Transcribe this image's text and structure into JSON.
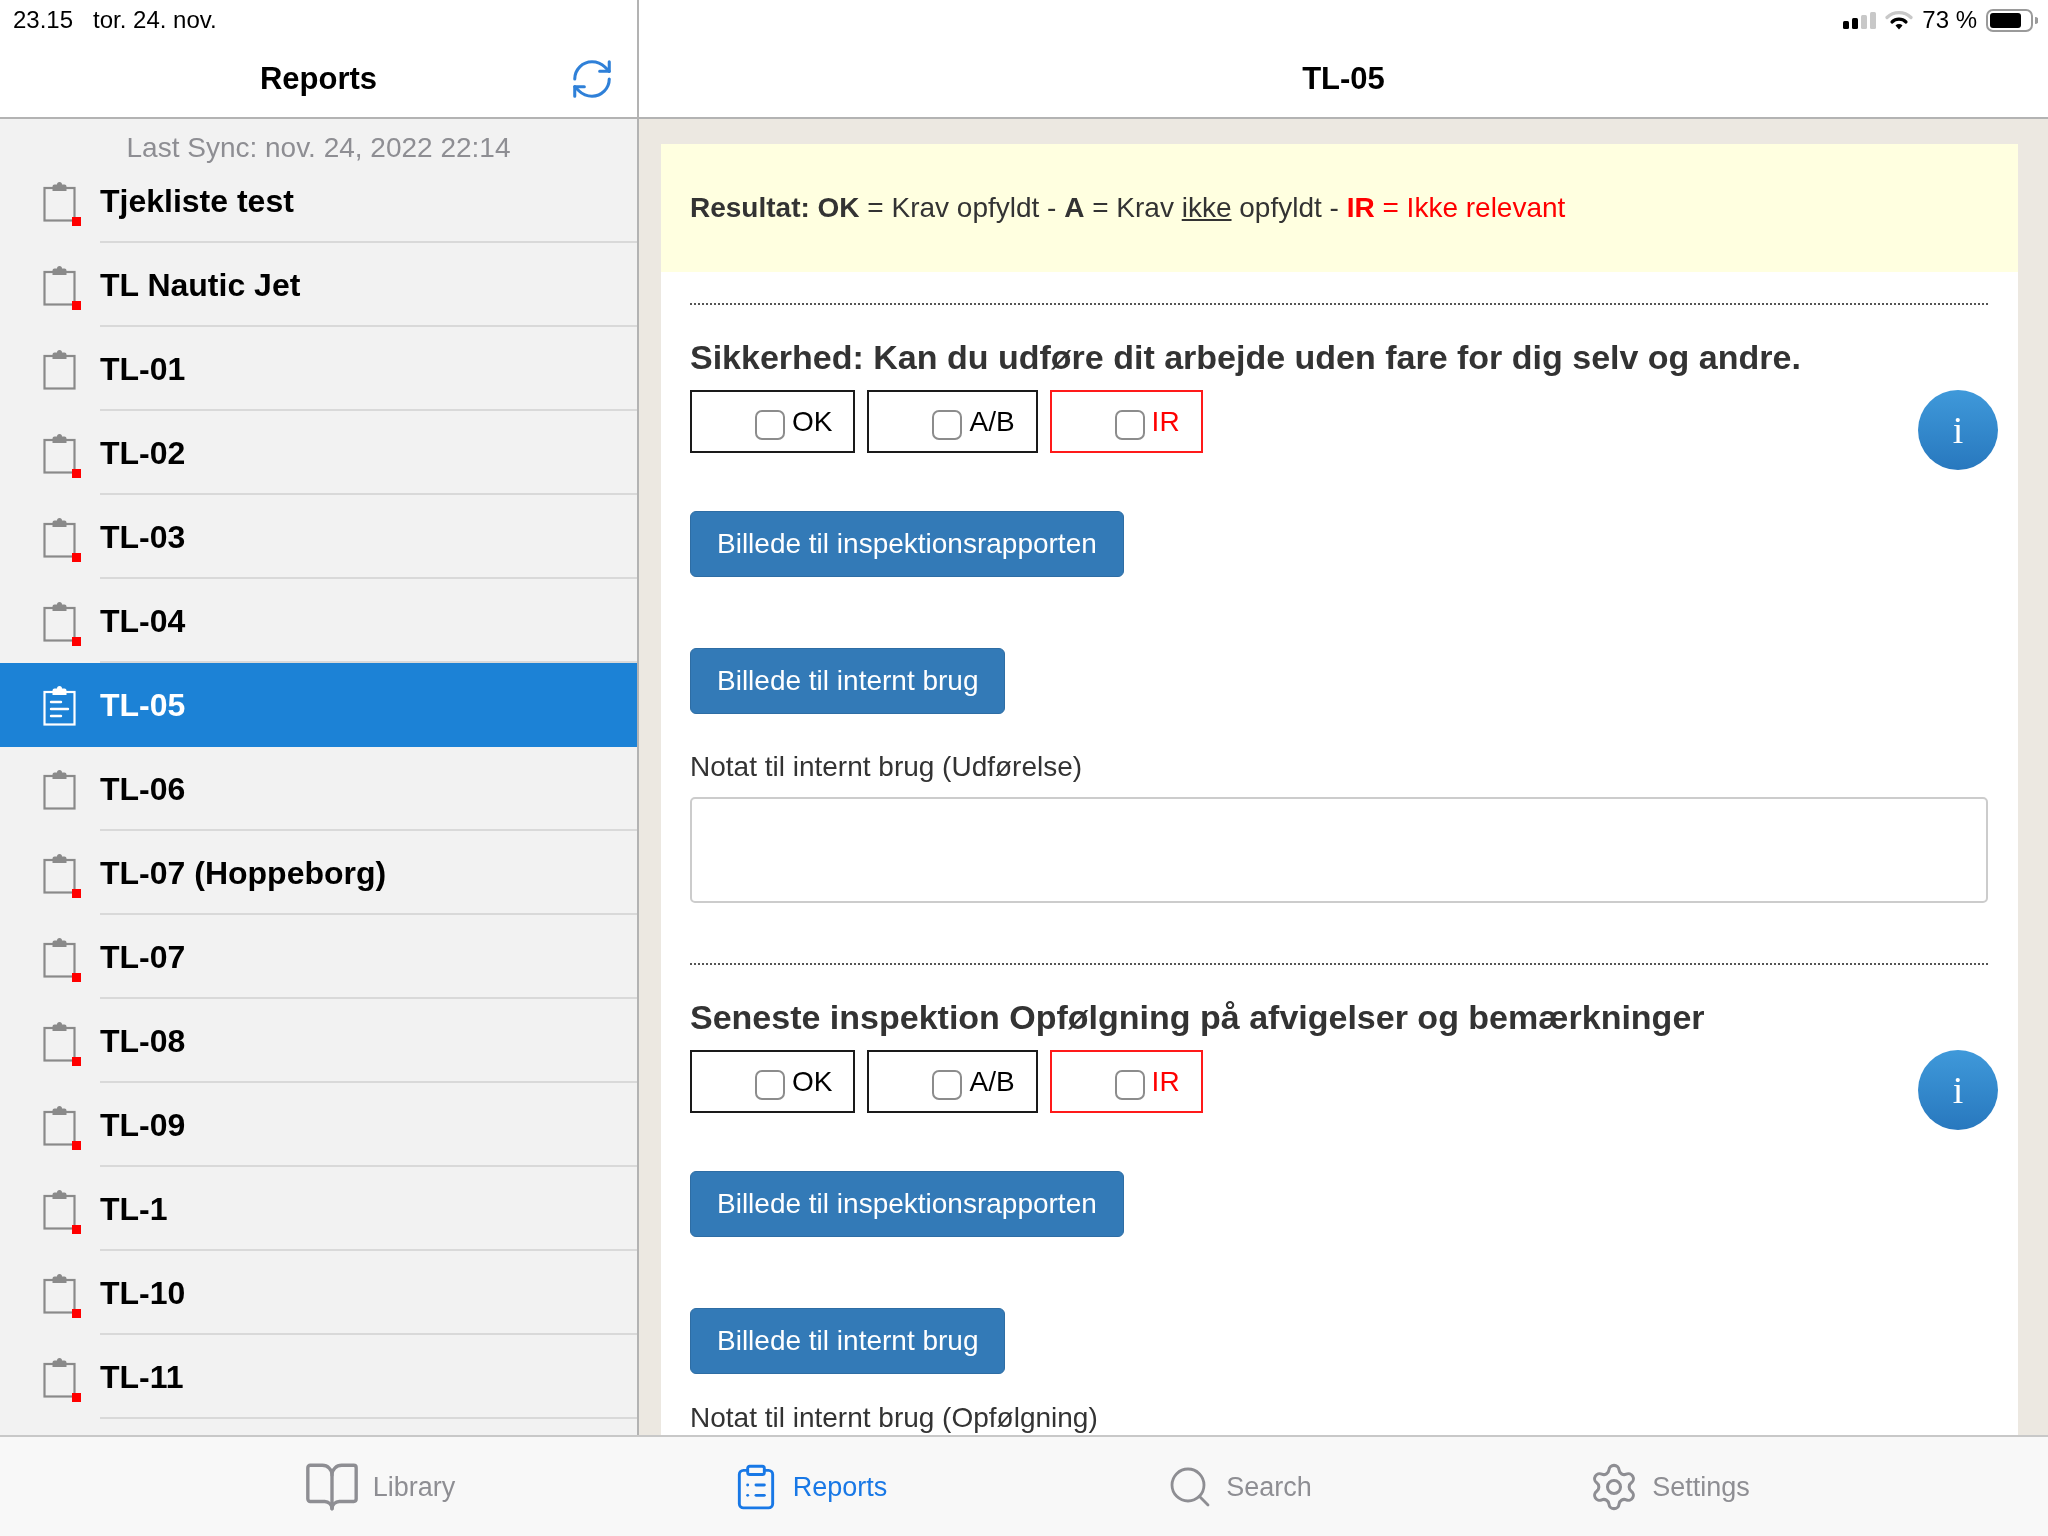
{
  "status_bar": {
    "time": "23.15",
    "date": "tor. 24. nov.",
    "battery": "73 %"
  },
  "sidebar": {
    "title": "Reports",
    "last_sync": "Last Sync: nov. 24, 2022 22:14",
    "items": [
      {
        "label": "Tjekliste test",
        "selected": false,
        "flagged": true
      },
      {
        "label": "TL Nautic Jet",
        "selected": false,
        "flagged": true
      },
      {
        "label": "TL-01",
        "selected": false,
        "flagged": false
      },
      {
        "label": "TL-02",
        "selected": false,
        "flagged": true
      },
      {
        "label": "TL-03",
        "selected": false,
        "flagged": true
      },
      {
        "label": "TL-04",
        "selected": false,
        "flagged": true
      },
      {
        "label": "TL-05",
        "selected": true,
        "flagged": false
      },
      {
        "label": "TL-06",
        "selected": false,
        "flagged": false
      },
      {
        "label": "TL-07 (Hoppeborg)",
        "selected": false,
        "flagged": true
      },
      {
        "label": "TL-07",
        "selected": false,
        "flagged": true
      },
      {
        "label": "TL-08",
        "selected": false,
        "flagged": true
      },
      {
        "label": "TL-09",
        "selected": false,
        "flagged": true
      },
      {
        "label": "TL-1",
        "selected": false,
        "flagged": true
      },
      {
        "label": "TL-10",
        "selected": false,
        "flagged": true
      },
      {
        "label": "TL-11",
        "selected": false,
        "flagged": true
      }
    ]
  },
  "detail": {
    "title": "TL-05",
    "legend": [
      {
        "text": "Resultat: OK",
        "bold": true,
        "underline": false,
        "warning": false
      },
      {
        "text": " = Krav opfyldt - ",
        "bold": false,
        "underline": false,
        "warning": false
      },
      {
        "text": "A",
        "bold": true,
        "underline": false,
        "warning": false
      },
      {
        "text": " = Krav ",
        "bold": false,
        "underline": false,
        "warning": false
      },
      {
        "text": "ikke",
        "bold": false,
        "underline": true,
        "warning": false
      },
      {
        "text": " opfyldt - ",
        "bold": false,
        "underline": false,
        "warning": false
      },
      {
        "text": "IR",
        "bold": true,
        "underline": false,
        "warning": true
      },
      {
        "text": " = Ikke relevant",
        "bold": false,
        "underline": false,
        "warning": true
      }
    ],
    "sections": [
      {
        "question": "Sikkerhed: Kan du udføre dit arbejde uden fare for dig selv og andre.",
        "options": [
          {
            "label": "OK",
            "kind": "plain",
            "checked": false
          },
          {
            "label": "A/B",
            "kind": "plain",
            "checked": false
          },
          {
            "label": "IR",
            "kind": "alert",
            "checked": false
          }
        ],
        "info": "i",
        "photo_buttons": [
          "Billede til inspektionsrapporten",
          "Billede til internt brug"
        ],
        "note_label": "Notat til internt brug (Udførelse)",
        "note_field": true
      },
      {
        "question": "Seneste inspektion Opfølgning på afvigelser og bemærkninger",
        "options": [
          {
            "label": "OK",
            "kind": "plain",
            "checked": false
          },
          {
            "label": "A/B",
            "kind": "plain",
            "checked": false
          },
          {
            "label": "IR",
            "kind": "alert",
            "checked": false
          }
        ],
        "info": "i",
        "photo_buttons": [
          "Billede til inspektionsrapporten",
          "Billede til internt brug"
        ],
        "note_label": "Notat til internt brug (Opfølgning)",
        "note_field": false
      }
    ]
  },
  "tab_bar": [
    {
      "label": "Library",
      "kind": "library",
      "selected": false
    },
    {
      "label": "Reports",
      "kind": "reports",
      "selected": true
    },
    {
      "label": "Search",
      "kind": "search",
      "selected": false
    },
    {
      "label": "Settings",
      "kind": "settings",
      "selected": false
    }
  ]
}
